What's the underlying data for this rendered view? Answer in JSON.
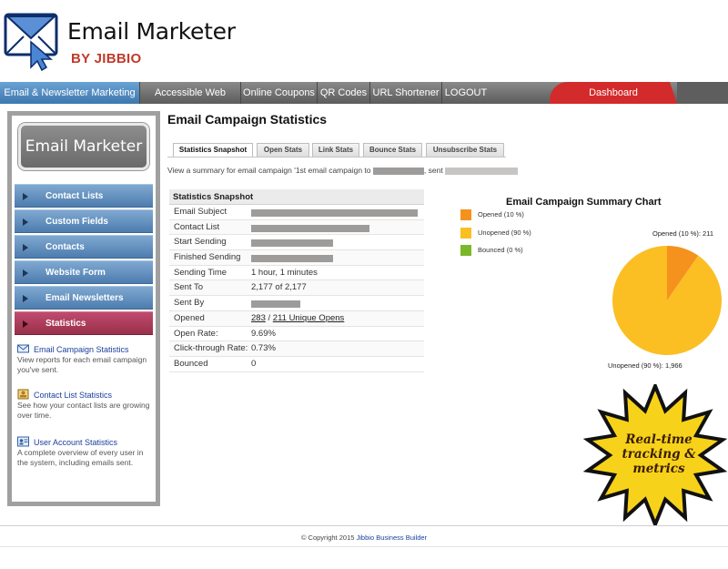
{
  "brand": {
    "title": "Email Marketer",
    "subtitle": "BY JIBBIO"
  },
  "nav": {
    "items": [
      {
        "label": "Email & Newsletter Marketing"
      },
      {
        "label": "Accessible Web Forms"
      },
      {
        "label": "Online Coupons"
      },
      {
        "label": "QR Codes"
      },
      {
        "label": "URL Shortener"
      },
      {
        "label": "LOGOUT"
      }
    ],
    "dashboard": "Dashboard"
  },
  "sidebar": {
    "logo_text": "Email Marketer",
    "items": [
      {
        "label": "Contact Lists"
      },
      {
        "label": "Custom Fields"
      },
      {
        "label": "Contacts"
      },
      {
        "label": "Website Form"
      },
      {
        "label": "Email Newsletters"
      },
      {
        "label": "Statistics"
      }
    ],
    "sub_items": [
      {
        "title": "Email Campaign Statistics",
        "desc": "View reports for each email campaign you've sent."
      },
      {
        "title": "Contact List Statistics",
        "desc": "See how your contact lists are growing over time."
      },
      {
        "title": "User Account Statistics",
        "desc": "A complete overview of every user in the system, including emails sent."
      }
    ]
  },
  "main": {
    "title": "Email Campaign Statistics",
    "tabs": [
      {
        "label": "Statistics Snapshot"
      },
      {
        "label": "Open Stats"
      },
      {
        "label": "Link Stats"
      },
      {
        "label": "Bounce Stats"
      },
      {
        "label": "Unsubscribe Stats"
      }
    ],
    "summary_prefix": "View a summary for email campaign '1st email campaign to",
    "summary_sent": ", sent"
  },
  "stats": {
    "header": "Statistics Snapshot",
    "rows": [
      {
        "label": "Email Subject",
        "value": ""
      },
      {
        "label": "Contact List",
        "value": ""
      },
      {
        "label": "Start Sending",
        "value": ""
      },
      {
        "label": "Finished Sending",
        "value": ""
      },
      {
        "label": "Sending Time",
        "value": "1 hour, 1 minutes"
      },
      {
        "label": "Sent To",
        "value": "2,177 of 2,177"
      },
      {
        "label": "Sent By",
        "value": ""
      },
      {
        "label": "Opened",
        "value": ""
      },
      {
        "label": "Open Rate:",
        "value": "9.69%"
      },
      {
        "label": "Click-through Rate:",
        "value": "0.73%"
      },
      {
        "label": "Bounced",
        "value": "0"
      }
    ],
    "opened_link": "283",
    "opened_sep": " / ",
    "opened_unique": "211 Unique Opens"
  },
  "chart_data": {
    "type": "pie",
    "title": "Email Campaign Summary Chart",
    "legend_position": "top-left",
    "slices": [
      {
        "name": "Opened (10 %)",
        "value": 211,
        "color": "#f5921e",
        "label": "Opened (10 %): 211"
      },
      {
        "name": "Unopened (90 %)",
        "value": 1966,
        "color": "#fbbf24",
        "label": "Unopened (90 %): 1,966"
      },
      {
        "name": "Bounced (0 %)",
        "value": 0,
        "color": "#7ab829"
      }
    ]
  },
  "promo": {
    "line1": "Real-time",
    "line2": "tracking &",
    "line3": "metrics"
  },
  "footer": {
    "copyright": "© Copyright 2015",
    "link": "Jibbio Business Builder"
  }
}
